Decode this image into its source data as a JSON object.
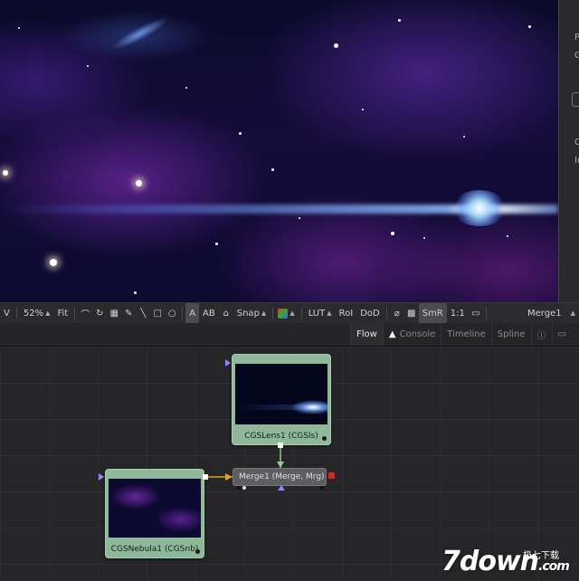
{
  "viewer": {
    "edge_labels": [
      "P",
      "G",
      "C",
      "In"
    ]
  },
  "toolbar": {
    "view_partial": "V",
    "zoom": "52%",
    "fit": "Fit",
    "snap": "Snap",
    "lut": "LUT",
    "roi": "RoI",
    "dod": "DoD",
    "smr": "SmR",
    "ratio": "1:1",
    "viewer_node": "Merge1",
    "tool_letter_a": "A",
    "tool_letters_ab": "AB"
  },
  "tabs": [
    {
      "label": "Flow",
      "active": true
    },
    {
      "label": "Console",
      "warning": true
    },
    {
      "label": "Timeline"
    },
    {
      "label": "Spline"
    }
  ],
  "nodes": {
    "lens": {
      "label": "CGSLens1  (CGSls)"
    },
    "nebula": {
      "label": "CGSNebula1  (CGSnb)"
    },
    "merge": {
      "label": "Merge1  (Merge, Mrg)"
    }
  },
  "watermark": {
    "logo": "7down",
    "suffix": ".com",
    "small_text": "极七下载"
  },
  "colors": {
    "node_green": "#8fb89a",
    "merge_gray": "#5e5e62",
    "accent_red": "#e02020",
    "connector_green": "#8fcf8f",
    "connector_yellow": "#e0a020"
  }
}
